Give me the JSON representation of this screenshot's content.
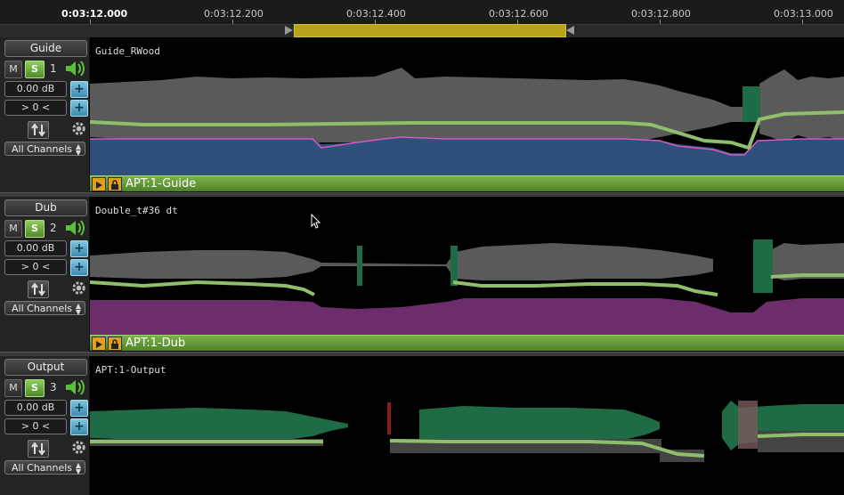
{
  "ruler": {
    "ticks": [
      "0:03:12.000",
      "0:03:12.200",
      "0:03:12.400",
      "0:03:12.600",
      "0:03:12.800",
      "0:03:13.000"
    ]
  },
  "tracks": [
    {
      "name": "Guide",
      "mute_label": "M",
      "solo_label": "S",
      "number": "1",
      "gain": "0.00 dB",
      "pan": "> 0 <",
      "channels": "All Channels",
      "clip_name": "Guide_RWood",
      "apt_label": "APT:1-Guide"
    },
    {
      "name": "Dub",
      "mute_label": "M",
      "solo_label": "S",
      "number": "2",
      "gain": "0.00 dB",
      "pan": "> 0 <",
      "channels": "All Channels",
      "clip_name": "Double_t#36 dt",
      "apt_label": "APT:1-Dub"
    },
    {
      "name": "Output",
      "mute_label": "M",
      "solo_label": "S",
      "number": "3",
      "gain": "0.00 dB",
      "pan": "> 0 <",
      "channels": "All Channels",
      "clip_name": "APT:1-Output"
    }
  ],
  "colors": {
    "solo_active": "#6aa83f",
    "loop_range": "#b6a41b",
    "guide_pitch_fill": "#2e5079",
    "dub_pitch_fill": "#6b2d6b",
    "waveform_gray": "#5e5e5e",
    "waveform_green": "#1f6b45",
    "curve_green": "#8fbf6a",
    "curve_pink": "#d45ac8"
  },
  "icons": [
    "speaker-icon",
    "plus-icon",
    "swap-arrows-icon",
    "gear-icon",
    "play-icon",
    "lock-icon",
    "mouse-cursor-icon"
  ]
}
